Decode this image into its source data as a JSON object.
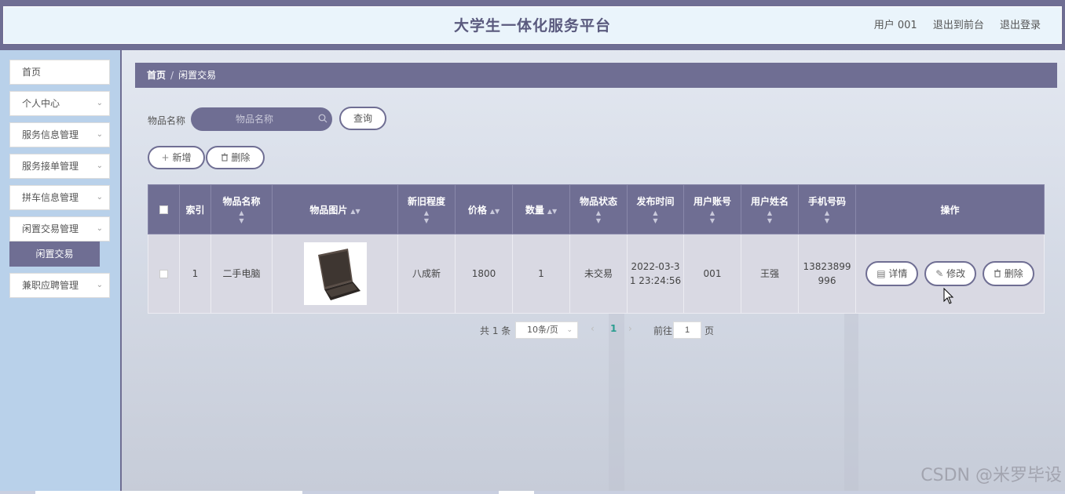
{
  "header": {
    "title": "大学生一体化服务平台",
    "user": "用户 001",
    "to_front": "退出到前台",
    "logout": "退出登录"
  },
  "sidebar": {
    "items": [
      {
        "label": "首页"
      },
      {
        "label": "个人中心"
      },
      {
        "label": "服务信息管理"
      },
      {
        "label": "服务接单管理"
      },
      {
        "label": "拼车信息管理"
      },
      {
        "label": "闲置交易管理"
      },
      {
        "label": "兼职应聘管理"
      }
    ],
    "active_sub": "闲置交易"
  },
  "breadcrumb": {
    "home": "首页",
    "sep": "/",
    "current": "闲置交易"
  },
  "search": {
    "label": "物品名称",
    "placeholder": "物品名称",
    "query_button": "查询"
  },
  "actions": {
    "add": "新增",
    "delete": "删除"
  },
  "table": {
    "headers": {
      "index": "索引",
      "name": "物品名称",
      "image": "物品图片",
      "condition": "新旧程度",
      "price": "价格",
      "quantity": "数量",
      "status": "物品状态",
      "publish_time": "发布时间",
      "account": "用户账号",
      "user_name": "用户姓名",
      "phone": "手机号码",
      "ops": "操作"
    },
    "rows": [
      {
        "index": "1",
        "name": "二手电脑",
        "condition": "八成新",
        "price": "1800",
        "quantity": "1",
        "status": "未交易",
        "publish_time_l1": "2022-03-3",
        "publish_time_l2": "1 23:24:56",
        "account": "001",
        "user_name": "王强",
        "phone_l1": "13823899",
        "phone_l2": "996",
        "detail": "详情",
        "edit": "修改",
        "delete": "删除"
      }
    ]
  },
  "pagination": {
    "total": "共 1 条",
    "page_size": "10条/页",
    "current_page": "1",
    "goto_label": "前往",
    "goto_value": "1",
    "page_unit": "页"
  },
  "watermark": "CSDN @米罗毕设",
  "colors": {
    "primary": "#6f6e93",
    "sidebar_bg": "#b9d1ea",
    "header_bg": "#eaf4fb"
  }
}
